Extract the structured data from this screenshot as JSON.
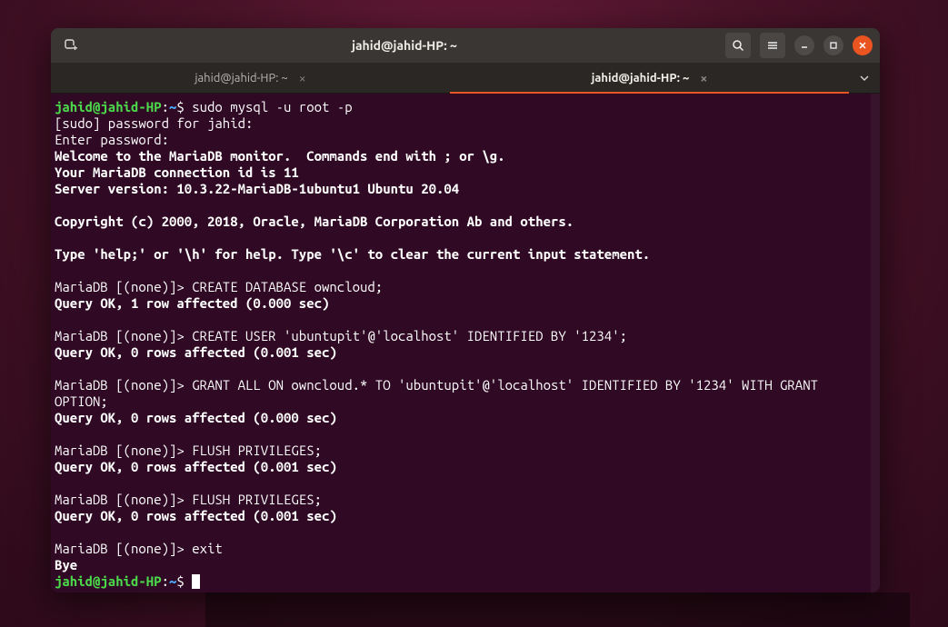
{
  "titlebar": {
    "title": "jahid@jahid-HP: ~"
  },
  "tabs": [
    {
      "label": "jahid@jahid-HP: ~",
      "active": false
    },
    {
      "label": "jahid@jahid-HP: ~",
      "active": true
    }
  ],
  "prompt": {
    "user_host": "jahid@jahid-HP",
    "sep": ":",
    "path": "~",
    "suffix": "$"
  },
  "lines": {
    "cmd1": " sudo mysql -u root -p",
    "l2": "[sudo] password for jahid:",
    "l3": "Enter password:",
    "l4": "Welcome to the MariaDB monitor.  Commands end with ; or \\g.",
    "l5": "Your MariaDB connection id is 11",
    "l6": "Server version: 10.3.22-MariaDB-1ubuntu1 Ubuntu 20.04",
    "l7": "",
    "l8": "Copyright (c) 2000, 2018, Oracle, MariaDB Corporation Ab and others.",
    "l9": "",
    "l10": "Type 'help;' or '\\h' for help. Type '\\c' to clear the current input statement.",
    "l11": "",
    "l12": "MariaDB [(none)]> CREATE DATABASE owncloud;",
    "l13": "Query OK, 1 row affected (0.000 sec)",
    "l14": "",
    "l15": "MariaDB [(none)]> CREATE USER 'ubuntupit'@'localhost' IDENTIFIED BY '1234';",
    "l16": "Query OK, 0 rows affected (0.001 sec)",
    "l17": "",
    "l18": "MariaDB [(none)]> GRANT ALL ON owncloud.* TO 'ubuntupit'@'localhost' IDENTIFIED BY '1234' WITH GRANT OPTION;",
    "l19": "Query OK, 0 rows affected (0.000 sec)",
    "l20": "",
    "l21": "MariaDB [(none)]> FLUSH PRIVILEGES;",
    "l22": "Query OK, 0 rows affected (0.001 sec)",
    "l23": "",
    "l24": "MariaDB [(none)]> FLUSH PRIVILEGES;",
    "l25": "Query OK, 0 rows affected (0.001 sec)",
    "l26": "",
    "l27": "MariaDB [(none)]> exit",
    "l28": "Bye"
  }
}
